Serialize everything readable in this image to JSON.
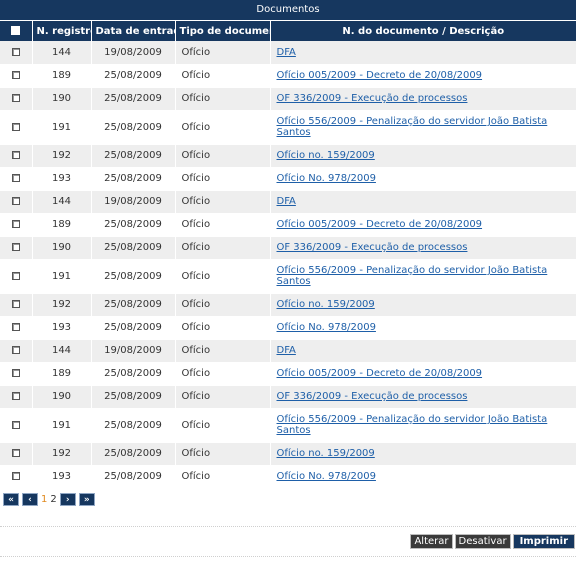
{
  "panel": {
    "title": "Documentos"
  },
  "columns": [
    "",
    "N. registro",
    "Data de entrada",
    "Tipo de documento",
    "N. do documento / Descrição"
  ],
  "rows": [
    {
      "reg": "144",
      "date": "19/08/2009",
      "type": "Ofício",
      "desc": "DFA",
      "tall": false
    },
    {
      "reg": "189",
      "date": "25/08/2009",
      "type": "Ofício",
      "desc": "Ofício 005/2009 - Decreto de 20/08/2009",
      "tall": false
    },
    {
      "reg": "190",
      "date": "25/08/2009",
      "type": "Ofício",
      "desc": "OF 336/2009 - Execução de processos",
      "tall": false
    },
    {
      "reg": "191",
      "date": "25/08/2009",
      "type": "Ofício",
      "desc": "Ofício 556/2009 - Penalização do servidor João Batista Santos",
      "tall": true
    },
    {
      "reg": "192",
      "date": "25/08/2009",
      "type": "Ofício",
      "desc": "Ofício no. 159/2009",
      "tall": false
    },
    {
      "reg": "193",
      "date": "25/08/2009",
      "type": "Ofício",
      "desc": "Ofício No. 978/2009",
      "tall": false
    },
    {
      "reg": "144",
      "date": "19/08/2009",
      "type": "Ofício",
      "desc": "DFA",
      "tall": false
    },
    {
      "reg": "189",
      "date": "25/08/2009",
      "type": "Ofício",
      "desc": "Ofício 005/2009 - Decreto de 20/08/2009",
      "tall": false
    },
    {
      "reg": "190",
      "date": "25/08/2009",
      "type": "Ofício",
      "desc": "OF 336/2009 - Execução de processos",
      "tall": false
    },
    {
      "reg": "191",
      "date": "25/08/2009",
      "type": "Ofício",
      "desc": "Ofício 556/2009 - Penalização do servidor João Batista Santos",
      "tall": true
    },
    {
      "reg": "192",
      "date": "25/08/2009",
      "type": "Ofício",
      "desc": "Ofício no. 159/2009",
      "tall": false
    },
    {
      "reg": "193",
      "date": "25/08/2009",
      "type": "Ofício",
      "desc": "Ofício No. 978/2009",
      "tall": false
    },
    {
      "reg": "144",
      "date": "19/08/2009",
      "type": "Ofício",
      "desc": "DFA",
      "tall": false
    },
    {
      "reg": "189",
      "date": "25/08/2009",
      "type": "Ofício",
      "desc": "Ofício 005/2009 - Decreto de 20/08/2009",
      "tall": false
    },
    {
      "reg": "190",
      "date": "25/08/2009",
      "type": "Ofício",
      "desc": "OF 336/2009 - Execução de processos",
      "tall": false
    },
    {
      "reg": "191",
      "date": "25/08/2009",
      "type": "Ofício",
      "desc": "Ofício 556/2009 - Penalização do servidor João Batista Santos",
      "tall": true
    },
    {
      "reg": "192",
      "date": "25/08/2009",
      "type": "Ofício",
      "desc": "Ofício no. 159/2009",
      "tall": false
    },
    {
      "reg": "193",
      "date": "25/08/2009",
      "type": "Ofício",
      "desc": "Ofício No. 978/2009",
      "tall": false
    }
  ],
  "pager": {
    "first": "«",
    "prev": "‹",
    "next": "›",
    "last": "»",
    "current_page": "1",
    "other_page": "2"
  },
  "actions": {
    "alterar": "Alterar",
    "desativar": "Desativar",
    "imprimir": "Imprimir"
  },
  "colors": {
    "header_bg": "#16375f",
    "link": "#1e5fa8",
    "current_page": "#e08a1e",
    "row_alt": "#eeeeee"
  }
}
